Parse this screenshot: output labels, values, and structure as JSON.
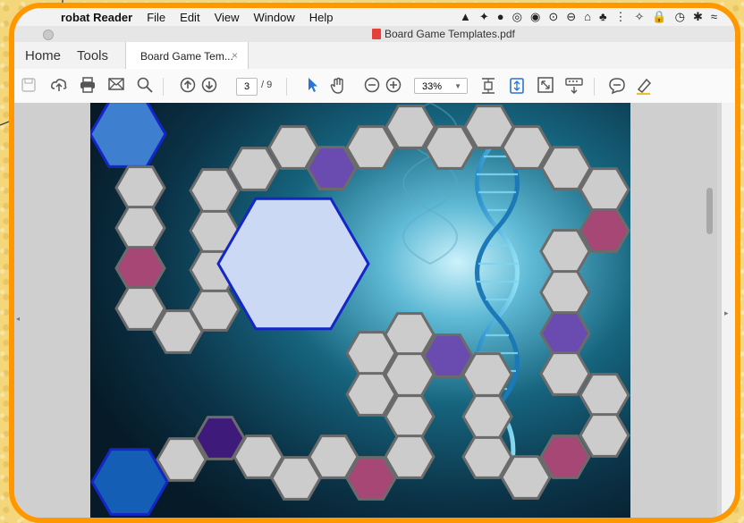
{
  "menubar": {
    "app_name": "robat Reader",
    "items": [
      "File",
      "Edit",
      "View",
      "Window",
      "Help"
    ],
    "status_icons": [
      "▲",
      "✦",
      "●",
      "◎",
      "◉",
      "⊙",
      "⊖",
      "⌂",
      "♣",
      "⋮",
      "✧",
      "🔒",
      "◷",
      "✱",
      "≈"
    ]
  },
  "window": {
    "title": "Board Game Templates.pdf"
  },
  "tabs": {
    "home": "Home",
    "tools": "Tools",
    "document": "Board Game Tem...",
    "close": "×"
  },
  "toolbar": {
    "page_current": "3",
    "page_total": "/ 9",
    "zoom": "33%"
  },
  "board": {
    "colors": {
      "gray": "#cccccc",
      "pink": "#a64775",
      "purple": "#6a4bb0",
      "dark_purple": "#3e1a7a",
      "blue_light": "#cbd9f5",
      "blue_mid": "#3f7fcf",
      "blue_dark": "#145fb5",
      "outline": "#6b6b6b",
      "blue_outline": "#1426c8"
    }
  }
}
